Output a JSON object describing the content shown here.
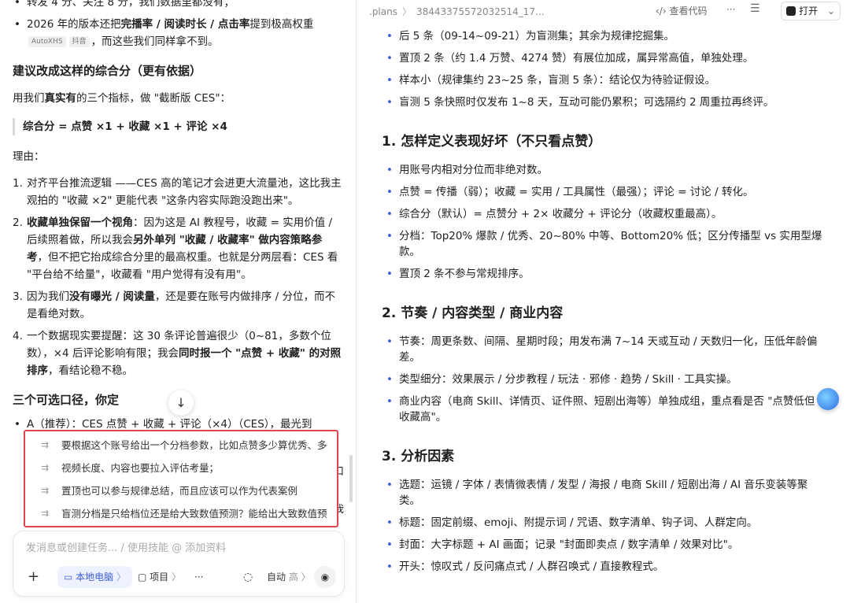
{
  "chat": {
    "line0": "转发 4 分、关注 8 分，我们数据里都没有；",
    "line1_pre": "2026 年的版本还把",
    "line1_bold": "完播率 / 阅读时长 / 点击率",
    "line1_post": "提到极高权重",
    "tag1": "AutoXHS",
    "tag2": "抖音",
    "line1_tail": "，而这些我们同样拿不到。",
    "heading1": "建议改成这样的综合分（更有依据）",
    "intro_pre": "用我们",
    "intro_bold": "真实有",
    "intro_post": "的三个指标，做 \"截断版 CES\"：",
    "formula": "综合分 = 点赞 ×1 + 收藏 ×1 + 评论 ×4",
    "reason_label": "理由：",
    "r1_num": "1.",
    "r1": "对齐平台推流逻辑 ——CES 高的笔记才会进更大流量池，这比我主观拍的 \"收藏 ×2\" 更能代表 \"这条内容实际跑没跑出来\"。",
    "r2_num": "2.",
    "r2_bold": "收藏单独保留一个视角",
    "r2_a": "：因为这是 AI 教程号，收藏 = 实用价值 / 后续照着做，所以我会",
    "r2_bold2": "另外单列 \"收藏 / 收藏率\" 做内容策略参考",
    "r2_b": "，但不把它抬成综合分里的最高权重。也就是分两层看：CES 看 \"平台给不给量\"，收藏看 \"用户觉得有没有用\"。",
    "r3_num": "3.",
    "r3_pre": "因为我们",
    "r3_bold": "没有曝光 / 阅读量",
    "r3_post": "，还是要在账号内做排序 / 分位，而不是看绝对数。",
    "r4_num": "4.",
    "r4_pre": "一个数据现实要提醒：这 30 条评论普遍很少（0~81，多数个位数），×4 后评论影响有限；我会",
    "r4_bold": "同时报一个 \"点赞 + 收藏\" 的对照排序",
    "r4_post": "，看结论稳不稳。",
    "heading2": "三个可选口径，你定",
    "partial": "A（推荐）：CES 点赞 + 收藏 + 评论（×4）（CES），最光到",
    "partial_r1": "口",
    "partial_r2": "我"
  },
  "suggestions": [
    "要根据这个账号给出一个分档参数，比如点赞多少算优秀、多",
    "视频长度、内容也要拉入评估考量；",
    "置顶也可以参与规律总结，而且应该可以作为代表案例",
    "盲测分档是只给档位还是给大致数值预测？能给出大致数值预"
  ],
  "composer": {
    "placeholder": "发消息或创建任务... / 使用技能 @ 添加资料",
    "plus": "+",
    "local_label": "本地电脑",
    "project_label": "项目",
    "more": "···",
    "mode_label": "自动",
    "mode_level": "高"
  },
  "topbar": {
    "path1": ".plans",
    "path2": "38443375572032514_17...",
    "view_code": "查看代码",
    "more": "···",
    "open": "打开"
  },
  "doc": {
    "top_bullets": [
      "后 5 条（09-14~09-21）为盲测集；其余为规律挖掘集。",
      "置顶 2 条（约 1.4 万赞、4274 赞）有展位加成，属异常高值，单独处理。",
      "样本小（规律集约 23~25 条，盲测 5 条）：结论仅为待验证假设。",
      "盲测 5 条快照时仅发布 1~8 天，互动可能仍累积；可选隔约 2 周重拉再终评。"
    ],
    "s1_title": "1. 怎样定义表现好坏（不只看点赞）",
    "s1_bullets": [
      "用账号内相对分位而非绝对数。",
      "点赞 = 传播（弱）；收藏 = 实用 / 工具属性（最强）；评论 = 讨论 / 转化。",
      "综合分（默认）= 点赞分 + 2× 收藏分 + 评论分（收藏权重最高）。",
      "分档：Top20% 爆款 / 优秀、20~80% 中等、Bottom20% 低；区分传播型 vs 实用型爆款。",
      "置顶 2 条不参与常规排序。"
    ],
    "s2_title": "2. 节奏 / 内容类型 / 商业内容",
    "s2_bullets": [
      "节奏：周更条数、间隔、星期时段；用发布满 7~14 天或互动 / 天数归一化，压低年龄偏差。",
      "类型细分：效果展示 / 分步教程 / 玩法 · 邪修 · 趋势 / Skill · 工具实操。",
      "商业内容（电商 Skill、详情页、证件照、短剧出海等）单独成组，重点看是否 \"点赞低但收藏高\"。"
    ],
    "s3_title": "3. 分析因素",
    "s3_bullets": [
      "选题：运镜 / 字体 / 表情微表情 / 发型 / 海报 / 电商 Skill / 短剧出海 / AI 音乐变装等聚类。",
      "标题：固定前缀、emoji、附提示词 / 咒语、数字清单、钩子词、人群定向。",
      "封面：大字标题 + AI 画面；记录 \"封面即卖点 / 数字清单 / 效果对比\"。",
      "开头：惊叹式 / 反问痛点式 / 人群召唤式 / 直接教程式。"
    ]
  },
  "colors": {
    "accent": "#3a5bd9",
    "highlight_border": "#e0454f"
  }
}
